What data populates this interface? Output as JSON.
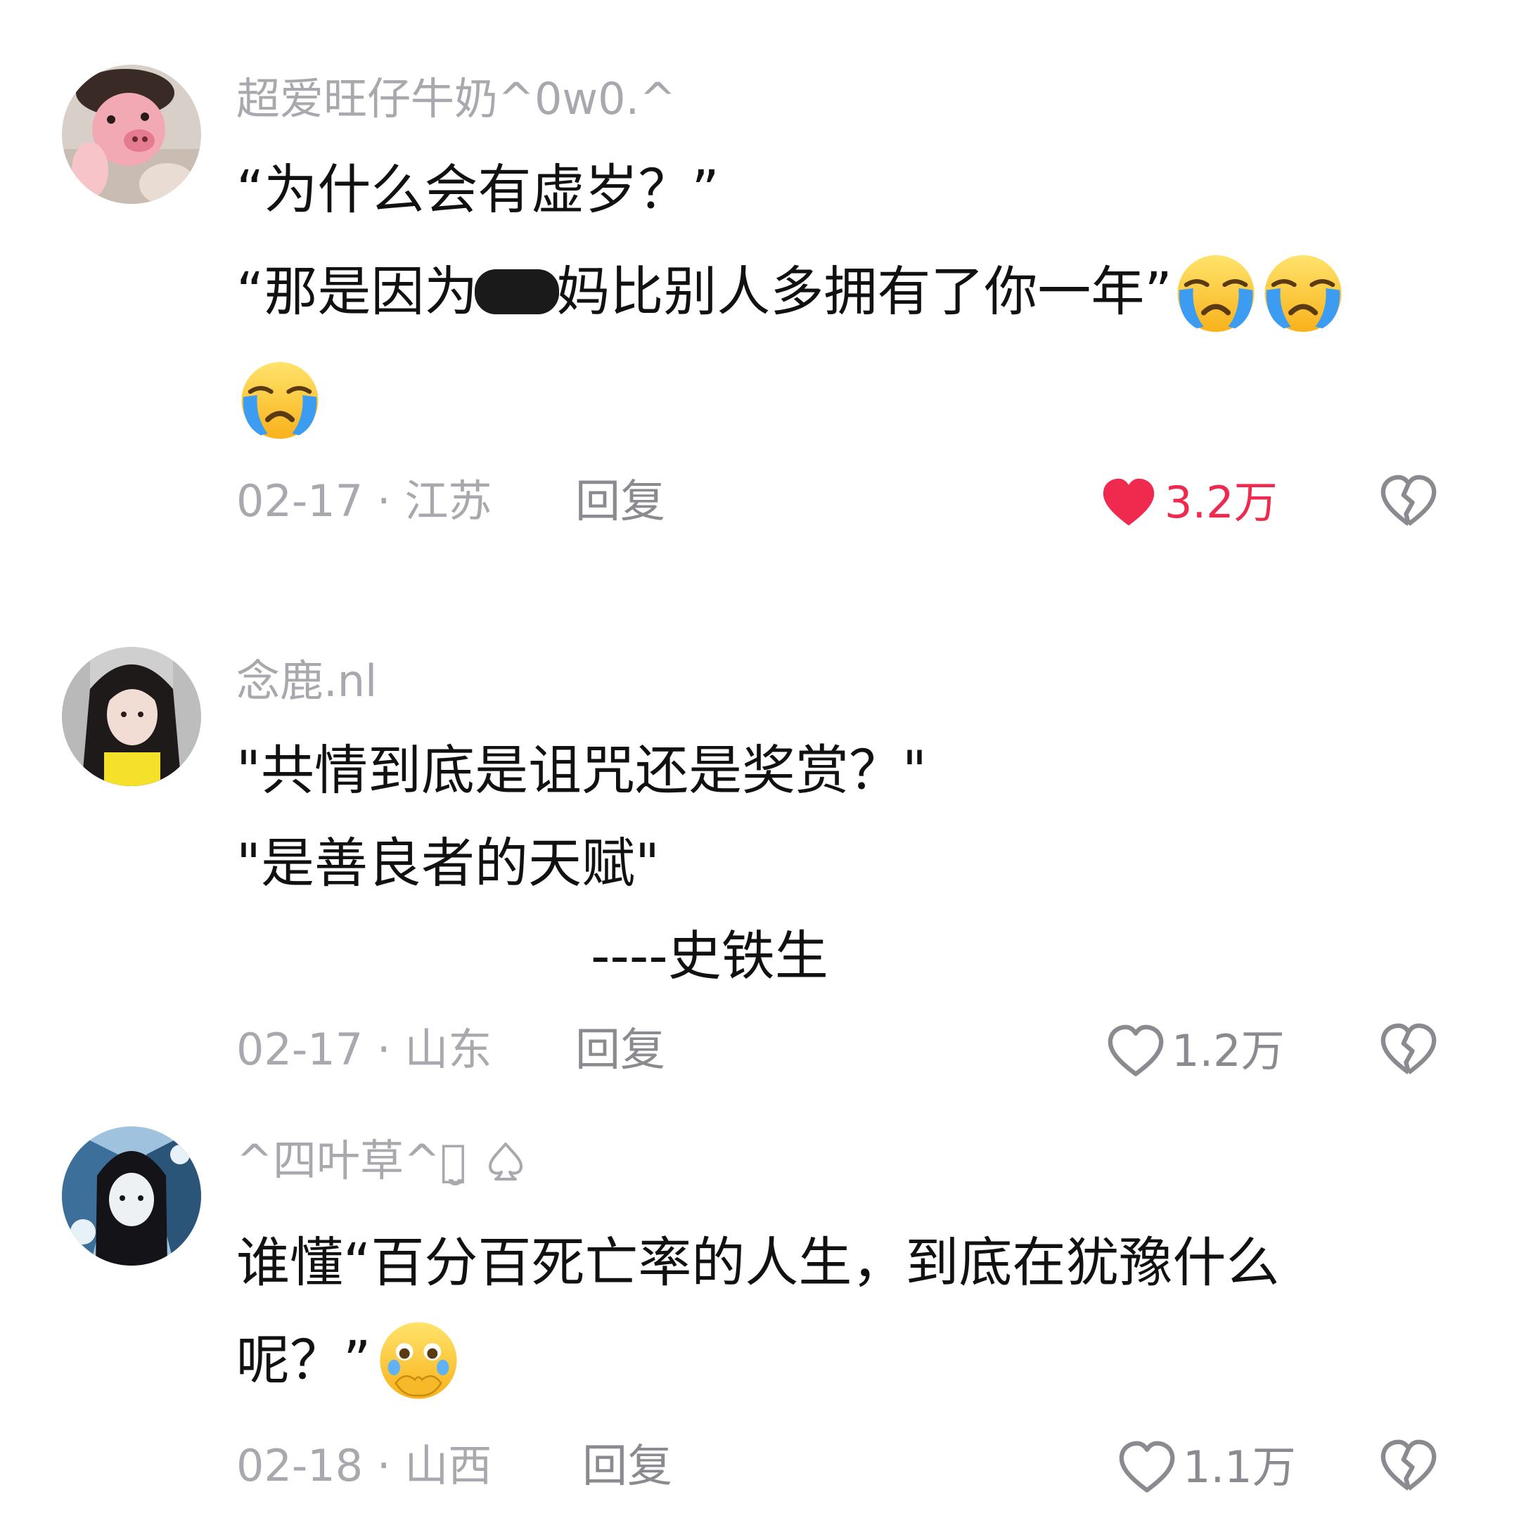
{
  "comments": [
    {
      "username": "超爱旺仔牛奶^0w0.^",
      "line1": "“为什么会有虚岁？”",
      "line2_pre": "“那是因为",
      "line2_post": "妈比别人多拥有了你一年”",
      "date": "02-17",
      "location": "江苏",
      "reply_label": "回复",
      "likes": "3.2万",
      "liked": true
    },
    {
      "username": "念鹿.nl",
      "line1": "\"共情到底是诅咒还是奖赏？\"",
      "line2": "\"是善良者的天赋\"",
      "line3": "----史铁生",
      "date": "02-17",
      "location": "山东",
      "reply_label": "回复",
      "likes": "1.2万",
      "liked": false
    },
    {
      "username": "^四叶草^ꪔ̤̮",
      "line1": "谁懂“百分百死亡率的人生，到底在犹豫什么",
      "line2": "呢？”",
      "date": "02-18",
      "location": "山西",
      "reply_label": "回复",
      "likes": "1.1万",
      "liked": false
    }
  ],
  "colors": {
    "like_active": "#f0294e",
    "meta_gray": "#a8a8ae",
    "text": "#111111"
  },
  "icons": {
    "crying": "loudly-crying-face",
    "holding_tears": "face-holding-back-tears",
    "heart": "heart-icon",
    "broken_heart": "broken-heart-icon",
    "spade": "spade-icon"
  }
}
